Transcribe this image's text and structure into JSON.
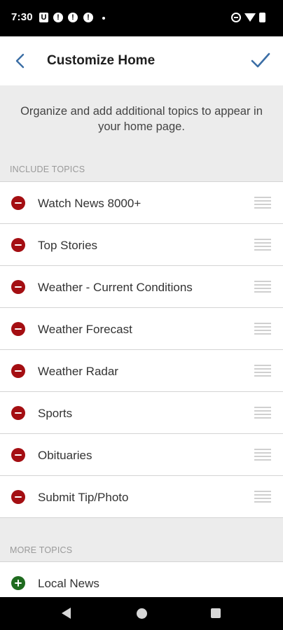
{
  "status_bar": {
    "time": "7:30",
    "left_icons": [
      "u-notification-icon",
      "alert-icon",
      "alert-icon",
      "alert-icon",
      "dot-icon"
    ],
    "right_icons": [
      "do-not-disturb-icon",
      "wifi-icon",
      "battery-icon"
    ]
  },
  "header": {
    "title": "Customize Home",
    "back_icon": "chevron-left-icon",
    "confirm_icon": "checkmark-icon",
    "accent_color": "#3b6ea5"
  },
  "intro": {
    "description": "Organize and add additional topics to appear in your home page.",
    "include_label": "INCLUDE TOPICS"
  },
  "topics": [
    {
      "label": "Watch News 8000+"
    },
    {
      "label": "Top Stories"
    },
    {
      "label": "Weather - Current Conditions"
    },
    {
      "label": "Weather Forecast"
    },
    {
      "label": "Weather Radar"
    },
    {
      "label": "Sports"
    },
    {
      "label": "Obituaries"
    },
    {
      "label": "Submit Tip/Photo"
    }
  ],
  "more": {
    "label": "MORE TOPICS",
    "items": [
      {
        "label": "Local News"
      }
    ]
  },
  "colors": {
    "remove": "#a40e12",
    "add": "#1f6b1f",
    "section_bg": "#ececec"
  }
}
